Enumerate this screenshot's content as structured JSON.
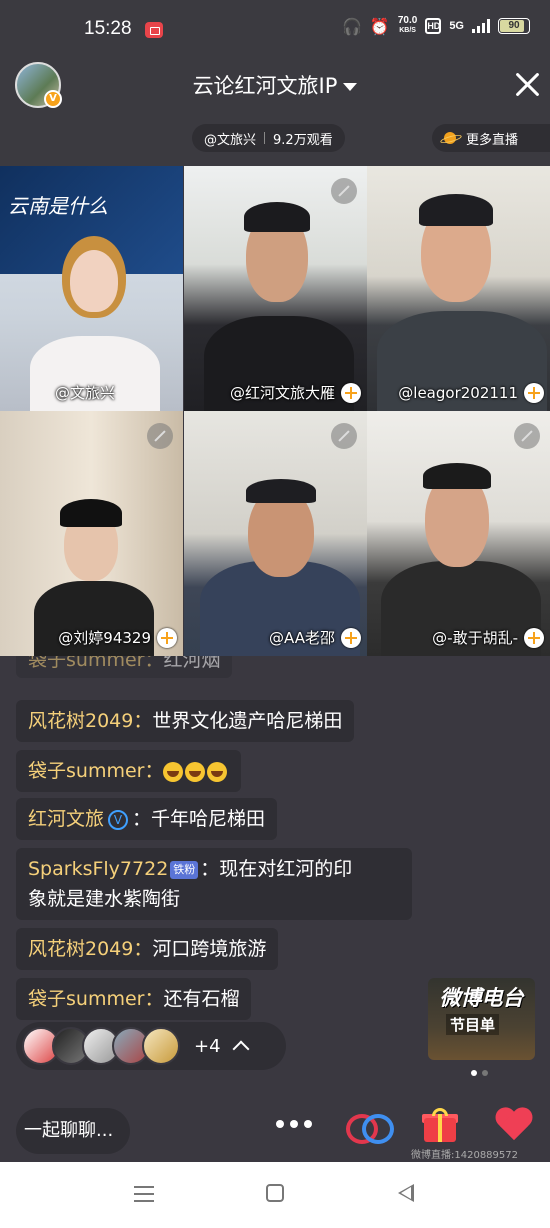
{
  "status": {
    "time": "15:28",
    "speed_value": "70.0",
    "speed_unit": "KB/S",
    "hd": "HD",
    "network": "5G",
    "battery": "90"
  },
  "header": {
    "title": "云论红河文旅IP",
    "host_name": "@文旅兴",
    "viewers": "9.2万观看",
    "more_live": "更多直播"
  },
  "poster_text": "云南是什么",
  "tiles": [
    {
      "label": "@文旅兴"
    },
    {
      "label": "@红河文旅大雁"
    },
    {
      "label": "@leagor202111"
    },
    {
      "label": "@刘婷94329"
    },
    {
      "label": "@AA老邵"
    },
    {
      "label": "@-敢于胡乱-"
    }
  ],
  "chat": [
    {
      "name": "袋子summer：",
      "text": "红河烟"
    },
    {
      "name": "风花树2049：",
      "text": "世界文化遗产哈尼梯田"
    },
    {
      "name": "袋子summer：",
      "text": ""
    },
    {
      "name": "红河文旅",
      "text": "：千年哈尼梯田",
      "vip": "V"
    },
    {
      "name": "SparksFly7722",
      "badge": "铁粉",
      "text": "：现在对红河的印",
      "text2": "象就是建水紫陶街"
    },
    {
      "name": "风花树2049：",
      "text": "河口跨境旅游"
    },
    {
      "name": "袋子summer：",
      "text": "还有石榴"
    }
  ],
  "viewer_more": "+4",
  "radio": {
    "line1": "微博电台",
    "line2": "节目单"
  },
  "bottom": {
    "chat_placeholder": "一起聊聊..."
  },
  "watermark": "微博直播:1420889572",
  "colors": {
    "background": "#3a3840",
    "name_yellow": "#f5d07a",
    "accent_orange": "#f7a21b"
  }
}
